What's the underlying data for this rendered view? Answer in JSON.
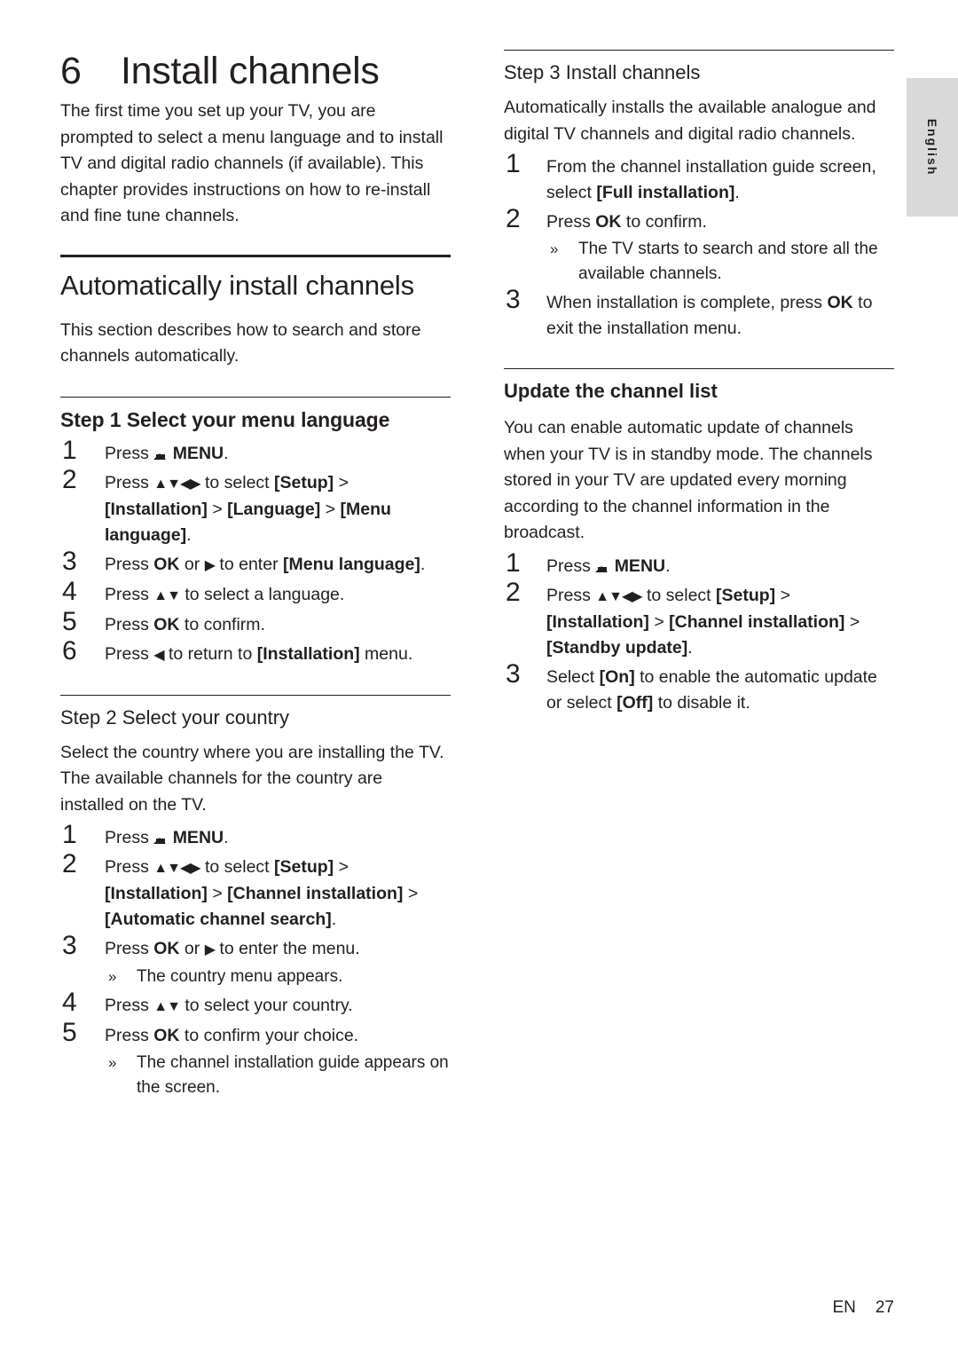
{
  "side_tab": {
    "label": "English"
  },
  "chapter": {
    "number": "6",
    "title": "Install channels"
  },
  "left": {
    "intro": "The first time you set up your TV, you are prompted to select a menu language and to install TV and digital radio channels (if available). This chapter provides instructions on how to re-install and fine tune channels.",
    "section_title": "Automatically install channels",
    "section_intro": "This section describes how to search and store channels automatically.",
    "step1": {
      "heading_step": "Step 1",
      "heading_rest": "Select your menu language",
      "items": [
        {
          "num": "1",
          "text_parts": [
            "Press ",
            "MENU",
            "."
          ]
        },
        {
          "num": "2",
          "text": "Press ▲▼◀▶ to select [Setup] > [Installation] > [Language] > [Menu language]."
        },
        {
          "num": "3",
          "text": "Press OK or ▶ to enter [Menu language]."
        },
        {
          "num": "4",
          "text": "Press ▲▼ to select a language."
        },
        {
          "num": "5",
          "text": "Press OK to confirm."
        },
        {
          "num": "6",
          "text": "Press ◀ to return to [Installation] menu."
        }
      ]
    },
    "step2": {
      "heading_step": "Step 2",
      "heading_rest": "Select your country",
      "body": "Select the country where you are installing the TV. The available channels for the country are installed on the TV.",
      "items": [
        {
          "num": "1",
          "text": "Press  MENU."
        },
        {
          "num": "2",
          "text": "Press ▲▼◀▶ to select [Setup] > [Installation] > [Channel installation] > [Automatic channel search]."
        },
        {
          "num": "3",
          "text": "Press OK or ▶ to enter the menu.",
          "sub": "The country menu appears."
        },
        {
          "num": "4",
          "text": "Press ▲▼ to select your country."
        },
        {
          "num": "5",
          "text": "Press OK to confirm your choice.",
          "sub": "The channel installation guide appears on the screen."
        }
      ]
    }
  },
  "right": {
    "step3": {
      "heading_step": "Step 3",
      "heading_rest": "Install channels",
      "body": "Automatically installs the available analogue and digital TV channels and digital radio channels.",
      "items": [
        {
          "num": "1",
          "text": "From the channel installation guide screen, select [Full installation]."
        },
        {
          "num": "2",
          "text": "Press OK to confirm.",
          "sub": "The TV starts to search and store all the available channels."
        },
        {
          "num": "3",
          "text": "When installation is complete, press OK to exit the installation menu."
        }
      ]
    },
    "update": {
      "heading": "Update the channel list",
      "body": "You can enable automatic update of channels when your TV is in standby mode. The channels stored in your TV are updated every morning according to the channel information in the broadcast.",
      "items": [
        {
          "num": "1",
          "text": "Press  MENU."
        },
        {
          "num": "2",
          "text": "Press ▲▼◀▶ to select [Setup] > [Installation] > [Channel installation] > [Standby update]."
        },
        {
          "num": "3",
          "text": "Select [On] to enable the automatic update or select [Off] to disable it."
        }
      ]
    }
  },
  "footer": {
    "lang": "EN",
    "page": "27"
  }
}
